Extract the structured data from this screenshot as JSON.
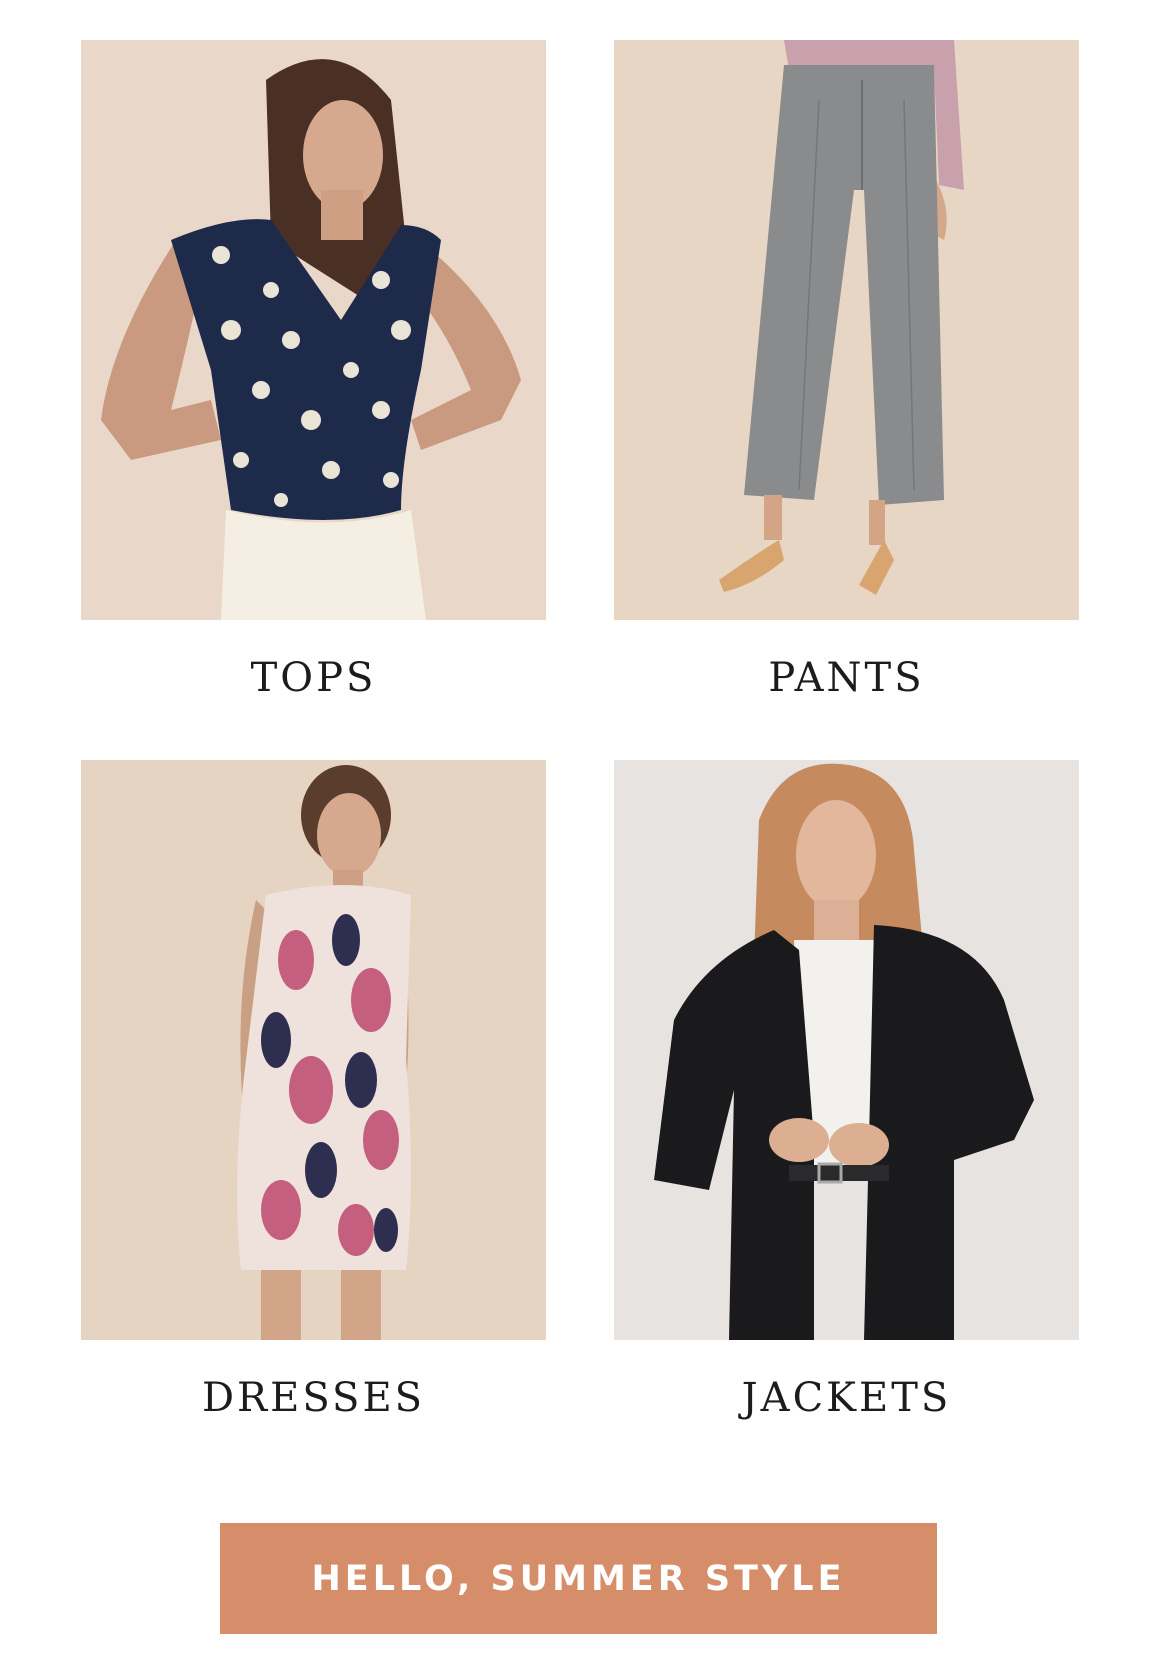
{
  "categories": [
    {
      "label": "TOPS",
      "image": "model-in-navy-floral-sleeveless-top"
    },
    {
      "label": "PANTS",
      "image": "model-in-grey-wide-leg-trousers"
    },
    {
      "label": "DRESSES",
      "image": "model-in-pink-navy-print-shift-dress"
    },
    {
      "label": "JACKETS",
      "image": "model-in-black-blazer"
    }
  ],
  "cta": {
    "label": "HELLO, SUMMER STYLE"
  },
  "colors": {
    "cta_background": "#d58d6a",
    "cta_text": "#ffffff",
    "label_text": "#1c1c1c",
    "photo_backdrop": "#e8d8c8"
  }
}
